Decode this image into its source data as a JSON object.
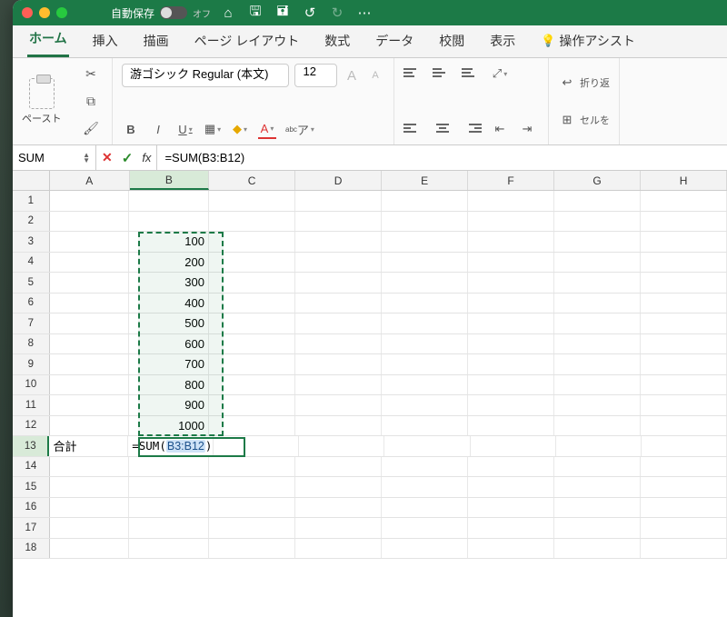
{
  "titlebar": {
    "autosave_label": "自動保存",
    "autosave_state": "オフ"
  },
  "tabs": {
    "home": "ホーム",
    "insert": "挿入",
    "draw": "描画",
    "layout": "ページ レイアウト",
    "formulas": "数式",
    "data": "データ",
    "review": "校閲",
    "view": "表示",
    "assist": "操作アシスト"
  },
  "ribbon": {
    "paste": "ペースト",
    "font_name": "游ゴシック Regular (本文)",
    "font_size": "12",
    "wrap": "折り返",
    "cellstyle": "セルを"
  },
  "formula_bar": {
    "name_box": "SUM",
    "formula": "=SUM(B3:B12)"
  },
  "columns": [
    "A",
    "B",
    "C",
    "D",
    "E",
    "F",
    "G",
    "H"
  ],
  "rows": [
    "1",
    "2",
    "3",
    "4",
    "5",
    "6",
    "7",
    "8",
    "9",
    "10",
    "11",
    "12",
    "13",
    "14",
    "15",
    "16",
    "17",
    "18"
  ],
  "cells": {
    "A13": "合計",
    "B3": "100",
    "B4": "200",
    "B5": "300",
    "B6": "400",
    "B7": "500",
    "B8": "600",
    "B9": "700",
    "B10": "800",
    "B11": "900",
    "B12": "1000",
    "B13_prefix": "=SUM(",
    "B13_ref": "B3:B12",
    "B13_suffix": ")"
  }
}
